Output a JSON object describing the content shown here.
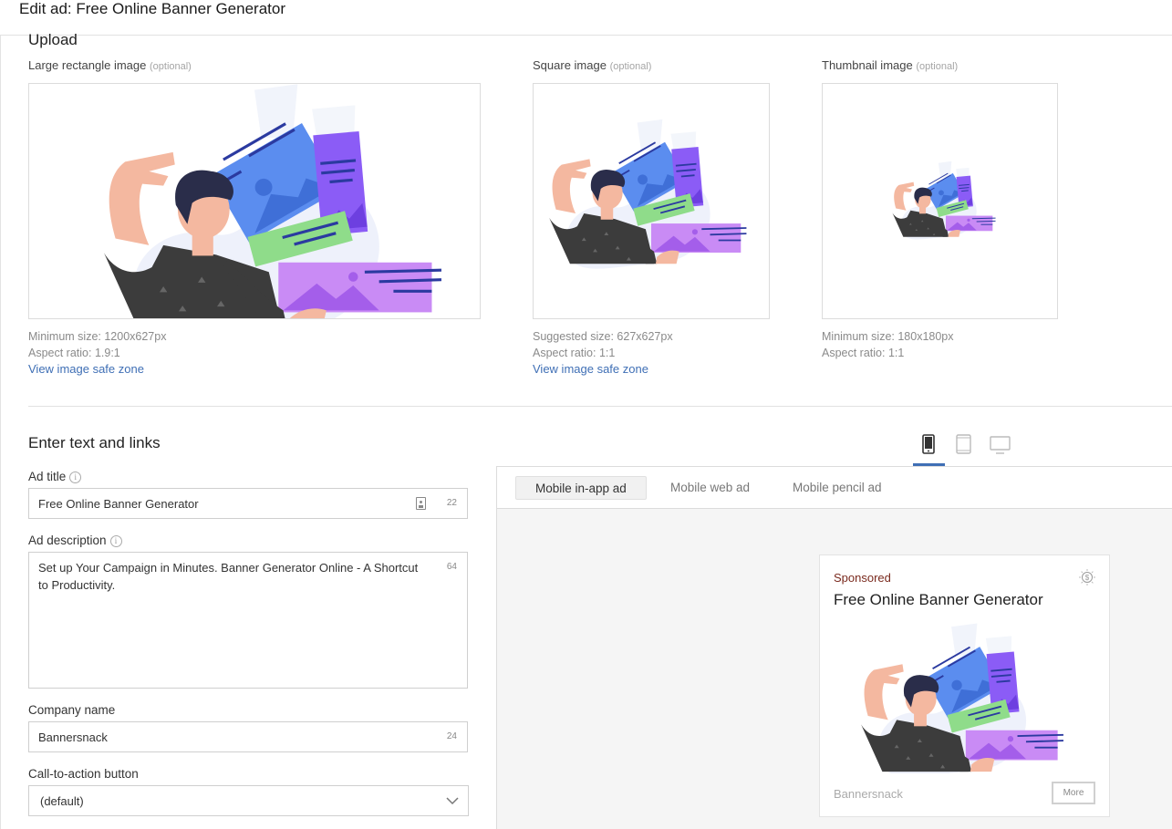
{
  "header": {
    "title": "Edit ad: Free Online Banner Generator"
  },
  "upload": {
    "title": "Upload",
    "large": {
      "label": "Large rectangle image",
      "optional": "(optional)",
      "meta_size": "Minimum size: 1200x627px",
      "meta_ratio": "Aspect ratio: 1.9:1",
      "link": "View image safe zone"
    },
    "square": {
      "label": "Square image",
      "optional": "(optional)",
      "meta_size": "Suggested size: 627x627px",
      "meta_ratio": "Aspect ratio: 1:1",
      "link": "View image safe zone"
    },
    "thumb": {
      "label": "Thumbnail image",
      "optional": "(optional)",
      "meta_size": "Minimum size: 180x180px",
      "meta_ratio": "Aspect ratio: 1:1"
    }
  },
  "text_links": {
    "title": "Enter text and links",
    "ad_title": {
      "label": "Ad title",
      "value": "Free Online Banner Generator",
      "count": "22"
    },
    "ad_description": {
      "label": "Ad description",
      "value": "Set up Your Campaign in Minutes. Banner Generator Online - A Shortcut to Productivity.",
      "count": "64"
    },
    "company": {
      "label": "Company name",
      "value": "Bannersnack",
      "count": "24"
    },
    "cta": {
      "label": "Call-to-action button",
      "value": "(default)"
    }
  },
  "device_icons": [
    "mobile-phone-icon",
    "tablet-icon",
    "desktop-monitor-icon"
  ],
  "preview": {
    "tabs": [
      "Mobile in-app ad",
      "Mobile web ad",
      "Mobile pencil ad"
    ],
    "active_tab": "Mobile in-app ad",
    "ad": {
      "sponsored": "Sponsored",
      "title": "Free Online Banner Generator",
      "company": "Bannersnack",
      "button": "More"
    }
  },
  "colors": {
    "link": "#3f6fb5",
    "sponsored": "#7a2a1e",
    "blue_card": "#5b8def",
    "purple_card": "#8b5cf6",
    "green_card": "#8fdc8a"
  }
}
